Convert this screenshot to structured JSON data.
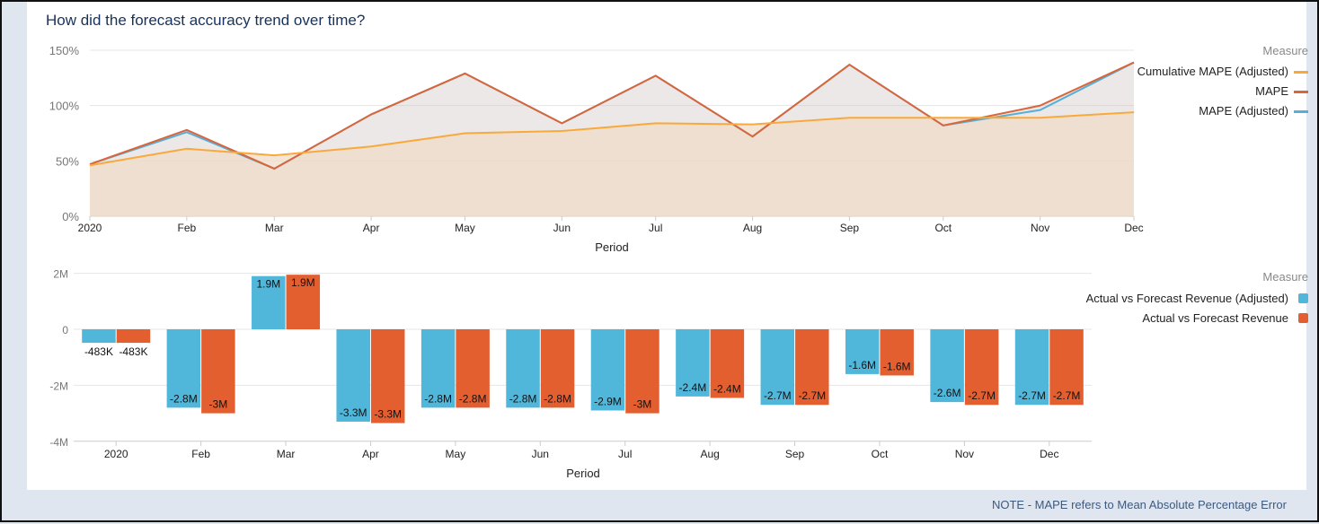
{
  "title": "How did the forecast accuracy trend over time?",
  "note": "NOTE - MAPE refers to Mean Absolute Percentage Error",
  "colors": {
    "cumulative": "#f9a93b",
    "mape": "#d9653a",
    "mape_adj": "#55afd6",
    "bar_adj": "#51b7da",
    "bar": "#e45f30"
  },
  "chart_data": [
    {
      "type": "line",
      "xlabel": "Period",
      "x": [
        "2020",
        "Feb",
        "Mar",
        "Apr",
        "May",
        "Jun",
        "Jul",
        "Aug",
        "Sep",
        "Oct",
        "Nov",
        "Dec"
      ],
      "yticks": [
        "0%",
        "50%",
        "100%",
        "150%"
      ],
      "ylim": [
        0,
        150
      ],
      "grid": true,
      "legend_title": "Measure",
      "legend_placement": "right",
      "series": [
        {
          "name": "Cumulative MAPE (Adjusted)",
          "values": [
            46,
            61,
            55,
            63,
            75,
            77,
            84,
            83,
            89,
            89,
            89,
            94
          ]
        },
        {
          "name": "MAPE",
          "values": [
            47,
            78,
            43,
            92,
            129,
            84,
            127,
            72,
            137,
            82,
            100,
            139
          ]
        },
        {
          "name": "MAPE (Adjusted)",
          "values": [
            47,
            76,
            43,
            92,
            129,
            84,
            127,
            72,
            137,
            82,
            96,
            139
          ]
        }
      ]
    },
    {
      "type": "bar",
      "xlabel": "Period",
      "categories": [
        "2020",
        "Feb",
        "Mar",
        "Apr",
        "May",
        "Jun",
        "Jul",
        "Aug",
        "Sep",
        "Oct",
        "Nov",
        "Dec"
      ],
      "yticks": [
        "-4M",
        "-2M",
        "0",
        "2M"
      ],
      "ylim": [
        -4,
        2
      ],
      "grid": true,
      "legend_title": "Measure",
      "legend_placement": "right",
      "series": [
        {
          "name": "Actual vs Forecast Revenue (Adjusted)",
          "values": [
            -0.483,
            -2.8,
            1.9,
            -3.3,
            -2.8,
            -2.8,
            -2.9,
            -2.4,
            -2.7,
            -1.6,
            -2.6,
            -2.7
          ],
          "labels": [
            "-483K",
            "-2.8M",
            "1.9M",
            "-3.3M",
            "-2.8M",
            "-2.8M",
            "-2.9M",
            "-2.4M",
            "-2.7M",
            "-1.6M",
            "-2.6M",
            "-2.7M"
          ]
        },
        {
          "name": "Actual vs Forecast Revenue",
          "values": [
            -0.483,
            -3.0,
            1.95,
            -3.35,
            -2.8,
            -2.8,
            -3.0,
            -2.45,
            -2.7,
            -1.65,
            -2.7,
            -2.7
          ],
          "labels": [
            "-483K",
            "-3M",
            "1.9M",
            "-3.3M",
            "-2.8M",
            "-2.8M",
            "-3M",
            "-2.4M",
            "-2.7M",
            "-1.6M",
            "-2.7M",
            "-2.7M"
          ]
        }
      ]
    }
  ]
}
